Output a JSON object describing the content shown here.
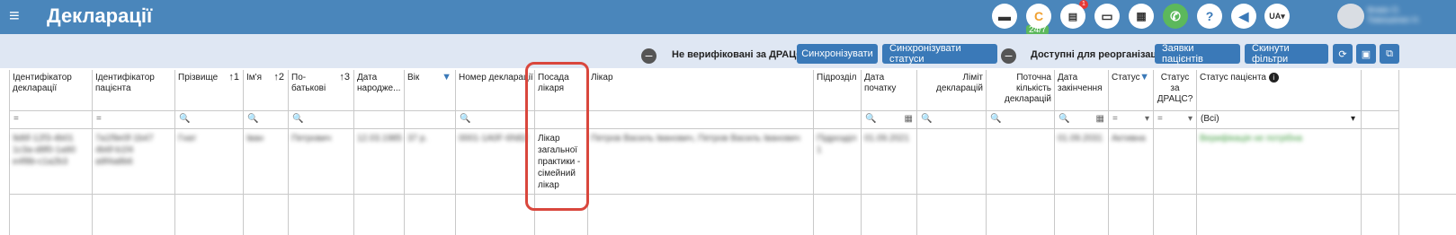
{
  "header": {
    "title": "Декларації",
    "badge_count": "1",
    "chat_badge": "24/7",
    "lang": "UA",
    "user_line1": "Фомін О.",
    "user_line2": "Тимошенко Н."
  },
  "toolbar": {
    "toggle1_label": "Не верифіковані за ДРАЦС",
    "sync_button": "Синхронізувати",
    "sync_status_button": "Синхронізувати статуси",
    "toggle2_label": "Доступні для реорганізації",
    "patient_requests_button": "Заявки пацієнтів",
    "reset_filters_button": "Скинути фільтри"
  },
  "table": {
    "columns": [
      {
        "label": "Ідентифікатор декларації",
        "filter": "="
      },
      {
        "label": "Ідентифікатор пацієнта",
        "filter": "="
      },
      {
        "label": "Прізвище",
        "sort": "↑1",
        "filter": "🔍"
      },
      {
        "label": "Ім'я",
        "sort": "↑2",
        "filter": "🔍"
      },
      {
        "label": "По-батькові",
        "sort": "↑3",
        "filter": "🔍"
      },
      {
        "label": "Дата народже...",
        "filter": ""
      },
      {
        "label": "Вік",
        "filter": ""
      },
      {
        "label": "Номер декларації",
        "filter": "🔍"
      },
      {
        "label": "Посада лікаря",
        "filter": ""
      },
      {
        "label": "Лікар",
        "filter": ""
      },
      {
        "label": "Підрозділ",
        "filter": ""
      },
      {
        "label": "Дата початку",
        "filter": "🔍"
      },
      {
        "label": "Ліміт декларацій",
        "filter": "🔍"
      },
      {
        "label": "Поточна кількість декларацій",
        "filter": "🔍"
      },
      {
        "label": "Дата закінчення",
        "filter": "🔍"
      },
      {
        "label": "Статус",
        "filter": "="
      },
      {
        "label": "Статус за ДРАЦС?",
        "filter": "="
      },
      {
        "label": "Статус пацієнта",
        "filter": "(Всі)"
      }
    ],
    "row": {
      "decl_id": "9d6f-12f3-4b01 1c3a-d8f0-1a90 e4f8b-c1a2b3",
      "patient_id": "7a1f9e0f-1b47 4b6f-b1f4 a9f4a8b6",
      "surname": "Гнат",
      "name": "Іван",
      "patronymic": "Петрович",
      "birth": "12.03.1985",
      "age": "37 р.",
      "decl_no": "0001-1A0F-6N82",
      "position": "Лікар загальної практики - сімейний лікар",
      "doctor": "Петров Василь Іванович, Петров Василь Іванович",
      "dept": "Підрозділ 1",
      "start": "01.09.2021",
      "end": "01.09.2031",
      "status": "Активна",
      "patient_status": "Верифікація не потрібна"
    }
  },
  "colors": {
    "topbar": "#4a86bb",
    "button": "#3a79b8",
    "highlight": "#d9473d"
  }
}
